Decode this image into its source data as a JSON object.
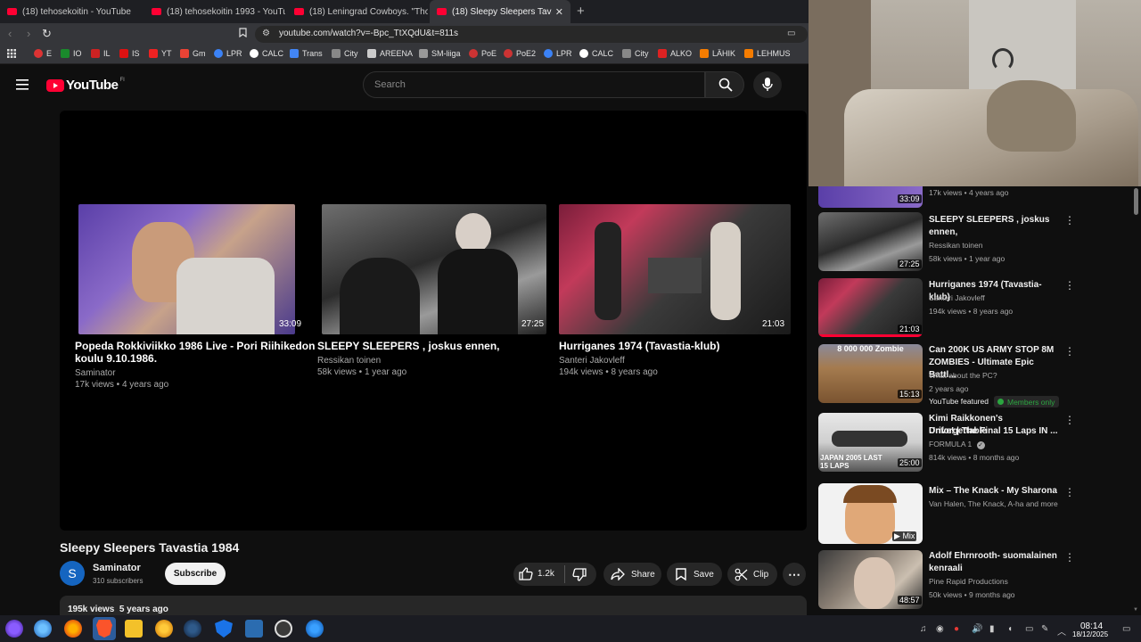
{
  "tabs": [
    {
      "label": "(18) tehosekoitin - YouTube",
      "active": false
    },
    {
      "label": "(18) tehosekoitin 1993 - YouTube",
      "active": false
    },
    {
      "label": "(18) Leningrad Cowboys. \"Those",
      "active": false
    },
    {
      "label": "(18) Sleepy Sleepers Tavastia",
      "active": true
    }
  ],
  "address": {
    "url": "youtube.com/watch?v=-Bpc_TtXQdU&t=811s"
  },
  "bookmarks": [
    "E",
    "IO",
    "IL",
    "IS",
    "YT",
    "Gm",
    "LPR",
    "CALC",
    "Trans",
    "City",
    "AREENA",
    "SM-liiga",
    "PoE",
    "PoE2",
    "LPR",
    "CALC",
    "City",
    "ALKO",
    "LÄHIK",
    "LEHMUS"
  ],
  "header": {
    "logo": "YouTube",
    "region": "FI",
    "search_placeholder": "Search"
  },
  "endcards": [
    {
      "title_line1": "Popeda Rokkiviikko 1986 Live - Pori Riihikedon",
      "title_line2": "koulu 9.10.1986.",
      "channel": "Saminator",
      "meta": "17k views • 4 years ago",
      "duration": "33:09"
    },
    {
      "title_line1": "SLEEPY SLEEPERS , joskus ennen,",
      "title_line2": "",
      "channel": "Ressikan toinen",
      "meta": "58k views • 1 year ago",
      "duration": "27:25"
    },
    {
      "title_line1": "Hurriganes 1974 (Tavastia-klub)",
      "title_line2": "",
      "channel": "Santeri Jakovleff",
      "meta": "194k views • 8 years ago",
      "duration": "21:03"
    }
  ],
  "video": {
    "title": "Sleepy Sleepers Tavastia 1984",
    "channel": "Saminator",
    "avatar_letter": "S",
    "subscribers": "310 subscribers",
    "subscribe_label": "Subscribe",
    "likes": "1.2k",
    "share_label": "Share",
    "save_label": "Save",
    "clip_label": "Clip",
    "views": "195k views",
    "date": "5 years ago"
  },
  "recommendations": [
    {
      "title1": "",
      "title2": "",
      "channel": "",
      "meta": "17k views • 4 years ago",
      "duration": "33:09"
    },
    {
      "title1": "SLEEPY SLEEPERS , joskus",
      "title2": "ennen,",
      "channel": "Ressikan toinen",
      "meta": "58k views • 1 year ago",
      "duration": "27:25"
    },
    {
      "title1": "Hurriganes 1974 (Tavastia-klub)",
      "title2": "",
      "channel": "Santeri Jakovleff",
      "meta": "194k views • 8 years ago",
      "duration": "21:03"
    },
    {
      "title1": "Can 200K US ARMY STOP 8M",
      "title2": "ZOMBIES - Ultimate Epic Battl...",
      "channel": "What about the PC?",
      "meta": "2 years ago",
      "featured": "YouTube featured",
      "members": "Members only",
      "thumb_text": "8 000 000 Zombie",
      "duration": "15:13"
    },
    {
      "title1": "Kimi Raikkonen's Unforgettable",
      "title2": "Drive! | The Final 15 Laps IN ...",
      "channel": "FORMULA 1",
      "meta": "814k views • 8 months ago",
      "thumb_text": "JAPAN 2005 LAST 15 LAPS",
      "duration": "25:00"
    },
    {
      "title1": "Mix – The Knack - My Sharona",
      "title2": "",
      "channel": "Van Halen, The Knack, A-ha and more",
      "meta": "",
      "duration": "Mix"
    },
    {
      "title1": "Adolf Ehrnrooth- suomalainen",
      "title2": "kenraali",
      "channel": "Pine Rapid Productions",
      "meta": "50k views • 9 months ago",
      "duration": "48:57"
    }
  ],
  "taskbar": {
    "time": "08:14",
    "date": "18/12/2025"
  },
  "colors": {
    "youtube_red": "#ff0033",
    "background": "#0f0f0f",
    "members_green": "#2ba640"
  }
}
